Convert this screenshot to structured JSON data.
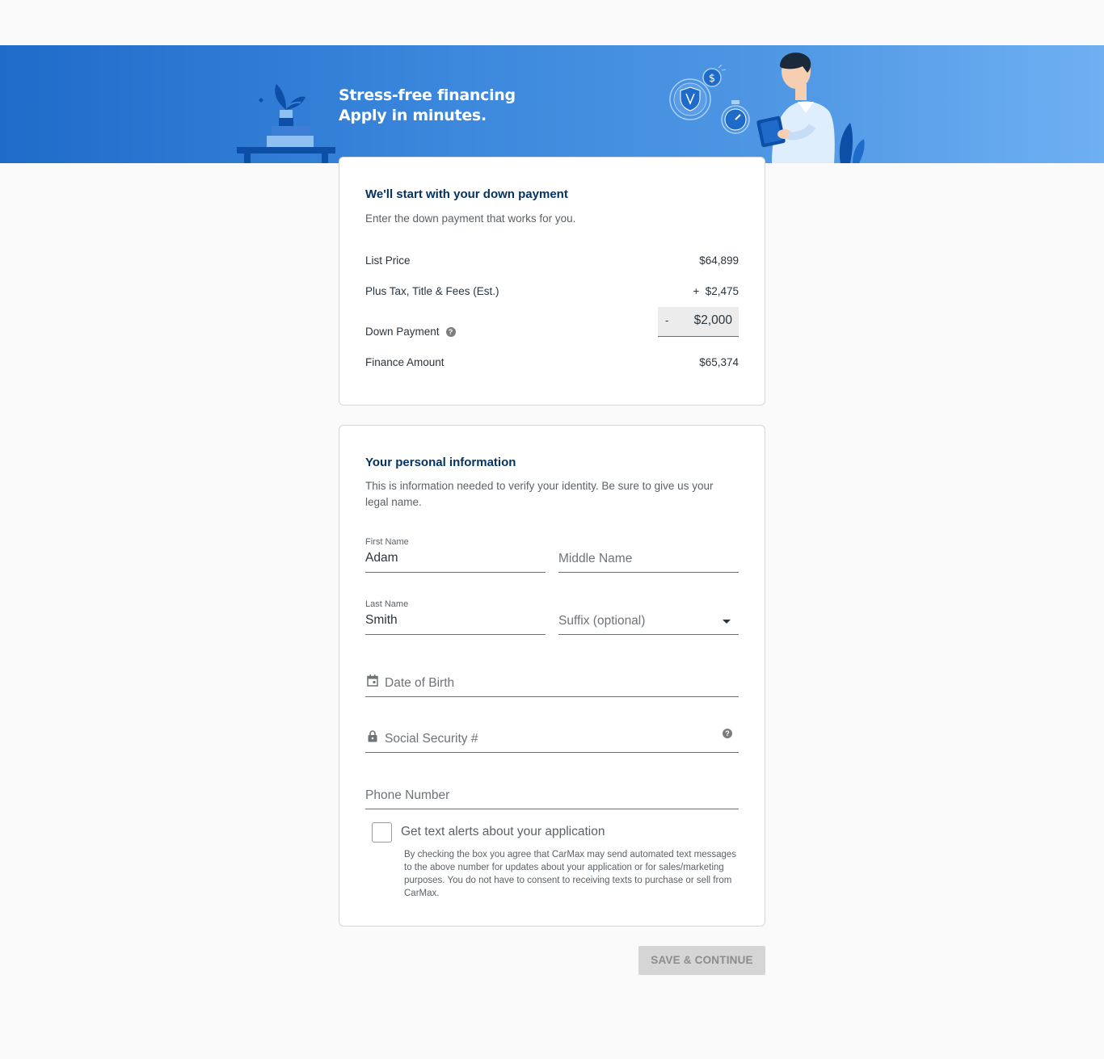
{
  "hero": {
    "line1": "Stress-free financing",
    "line2": "Apply in minutes."
  },
  "down_payment": {
    "title": "We'll start with your down payment",
    "subtitle": "Enter the down payment that works for you.",
    "list_price_label": "List Price",
    "list_price_value": "$64,899",
    "fees_label": "Plus Tax, Title & Fees (Est.)",
    "fees_value": "+  $2,475",
    "down_payment_label": "Down Payment",
    "down_payment_sign": "-",
    "down_payment_value": "$2,000",
    "finance_label": "Finance Amount",
    "finance_value": "$65,374",
    "help_icon": "question-circle-icon"
  },
  "personal_info": {
    "title": "Your personal information",
    "subtitle": "This is information needed to verify your identity. Be sure to give us your legal name.",
    "first_name_label": "First Name",
    "first_name_value": "Adam",
    "middle_name_placeholder": "Middle Name",
    "last_name_label": "Last Name",
    "last_name_value": "Smith",
    "suffix_placeholder": "Suffix (optional)",
    "dob_placeholder": "Date of Birth",
    "ssn_placeholder": "Social Security #",
    "phone_placeholder": "Phone Number",
    "text_alerts_label": "Get text alerts about your application",
    "text_alerts_checked": false,
    "legal_text": "By checking the box you agree that CarMax may send automated text messages to the above number for updates about your application or for sales/marketing purposes. You do not have to consent to receiving texts to purchase or sell from CarMax."
  },
  "actions": {
    "save_continue": "SAVE & CONTINUE"
  },
  "colors": {
    "brand_dark": "#053361",
    "hero_blue": "#1f6bc9",
    "disabled_button": "#d5d5d5"
  }
}
